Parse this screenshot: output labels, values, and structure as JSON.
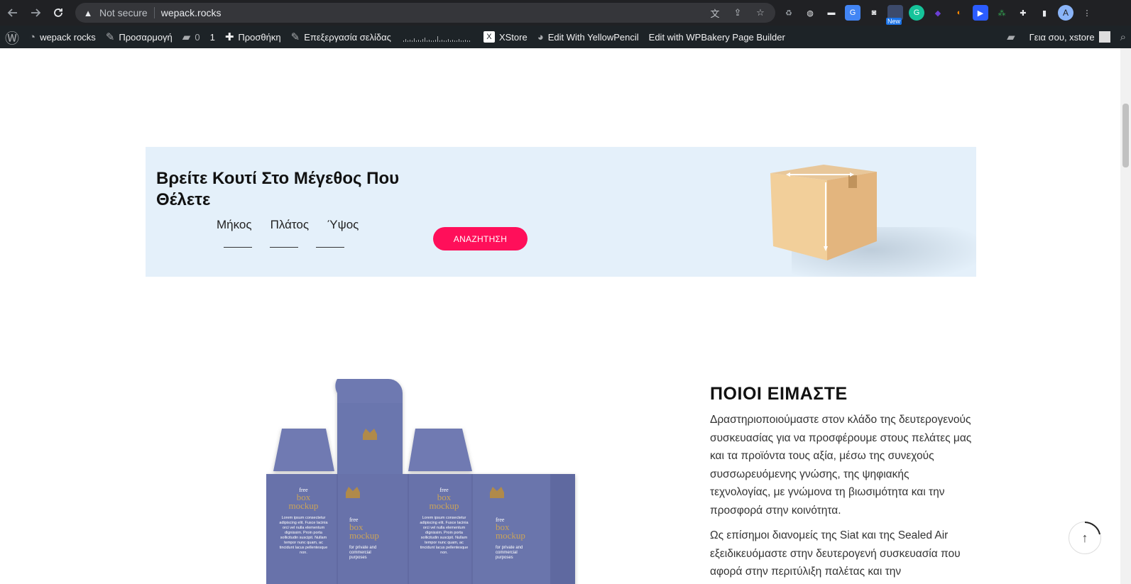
{
  "browser": {
    "security_label": "Not secure",
    "url": "wepack.rocks",
    "ext_new_badge": "New",
    "profile_initial": "A"
  },
  "wp_admin_bar": {
    "site_name": "wepack rocks",
    "customize": "Προσαρμογή",
    "comments_count": "0",
    "updates_count": "1",
    "new_label": "Προσθήκη",
    "edit_page": "Επεξεργασία σελίδας",
    "xstore": "XStore",
    "yellowpencil": "Edit With YellowPencil",
    "wpbakery": "Edit with WPBakery Page Builder",
    "greeting": "Γεια σου, xstore"
  },
  "search_band": {
    "title": "Βρείτε Κουτί Στο Μέγεθος Που Θέλετε",
    "length_label": "Μήκος",
    "width_label": "Πλάτος",
    "height_label": "Ύψος",
    "button_label": "ΑΝΑΖΗΤΗΣΗ",
    "button_color": "#ff0f5a",
    "background_color": "#e4f0fa"
  },
  "about": {
    "title": "ΠΟΙΟΙ ΕΙΜΑΣΤΕ",
    "paragraph1": "Δραστηριοποιούμαστε στον κλάδο της δευτερογενούς συσκευασίας για να προσφέρουμε στους πελάτες μας και τα προϊόντα τους αξία, μέσω της συνεχούς συσσωρευόμενης γνώσης, της ψηφιακής τεχνολογίας, με γνώμονα τη βιωσιμότητα και την προσφορά στην κοινότητα.",
    "paragraph2": "Ως επίσημοι διανομείς της Siat και της Sealed Air εξειδικευόμαστε στην δευτερογενή συσκευασία που αφορά στην περιτύλιξη παλέτας και την"
  },
  "mockup": {
    "free": "free",
    "box": "box",
    "mockup_word": "mockup",
    "lorem": "Lorem ipsum consectetur adipiscing elit. Fusce lacinia orci vel nulla elementum dignissim. Proin porta sollicitudin suscipit. Nullam tempor nunc quam, ac tincidunt lacus pellentesque non.",
    "for_private": "for private and commercial purposes",
    "panel_color": "#6b76ae"
  }
}
